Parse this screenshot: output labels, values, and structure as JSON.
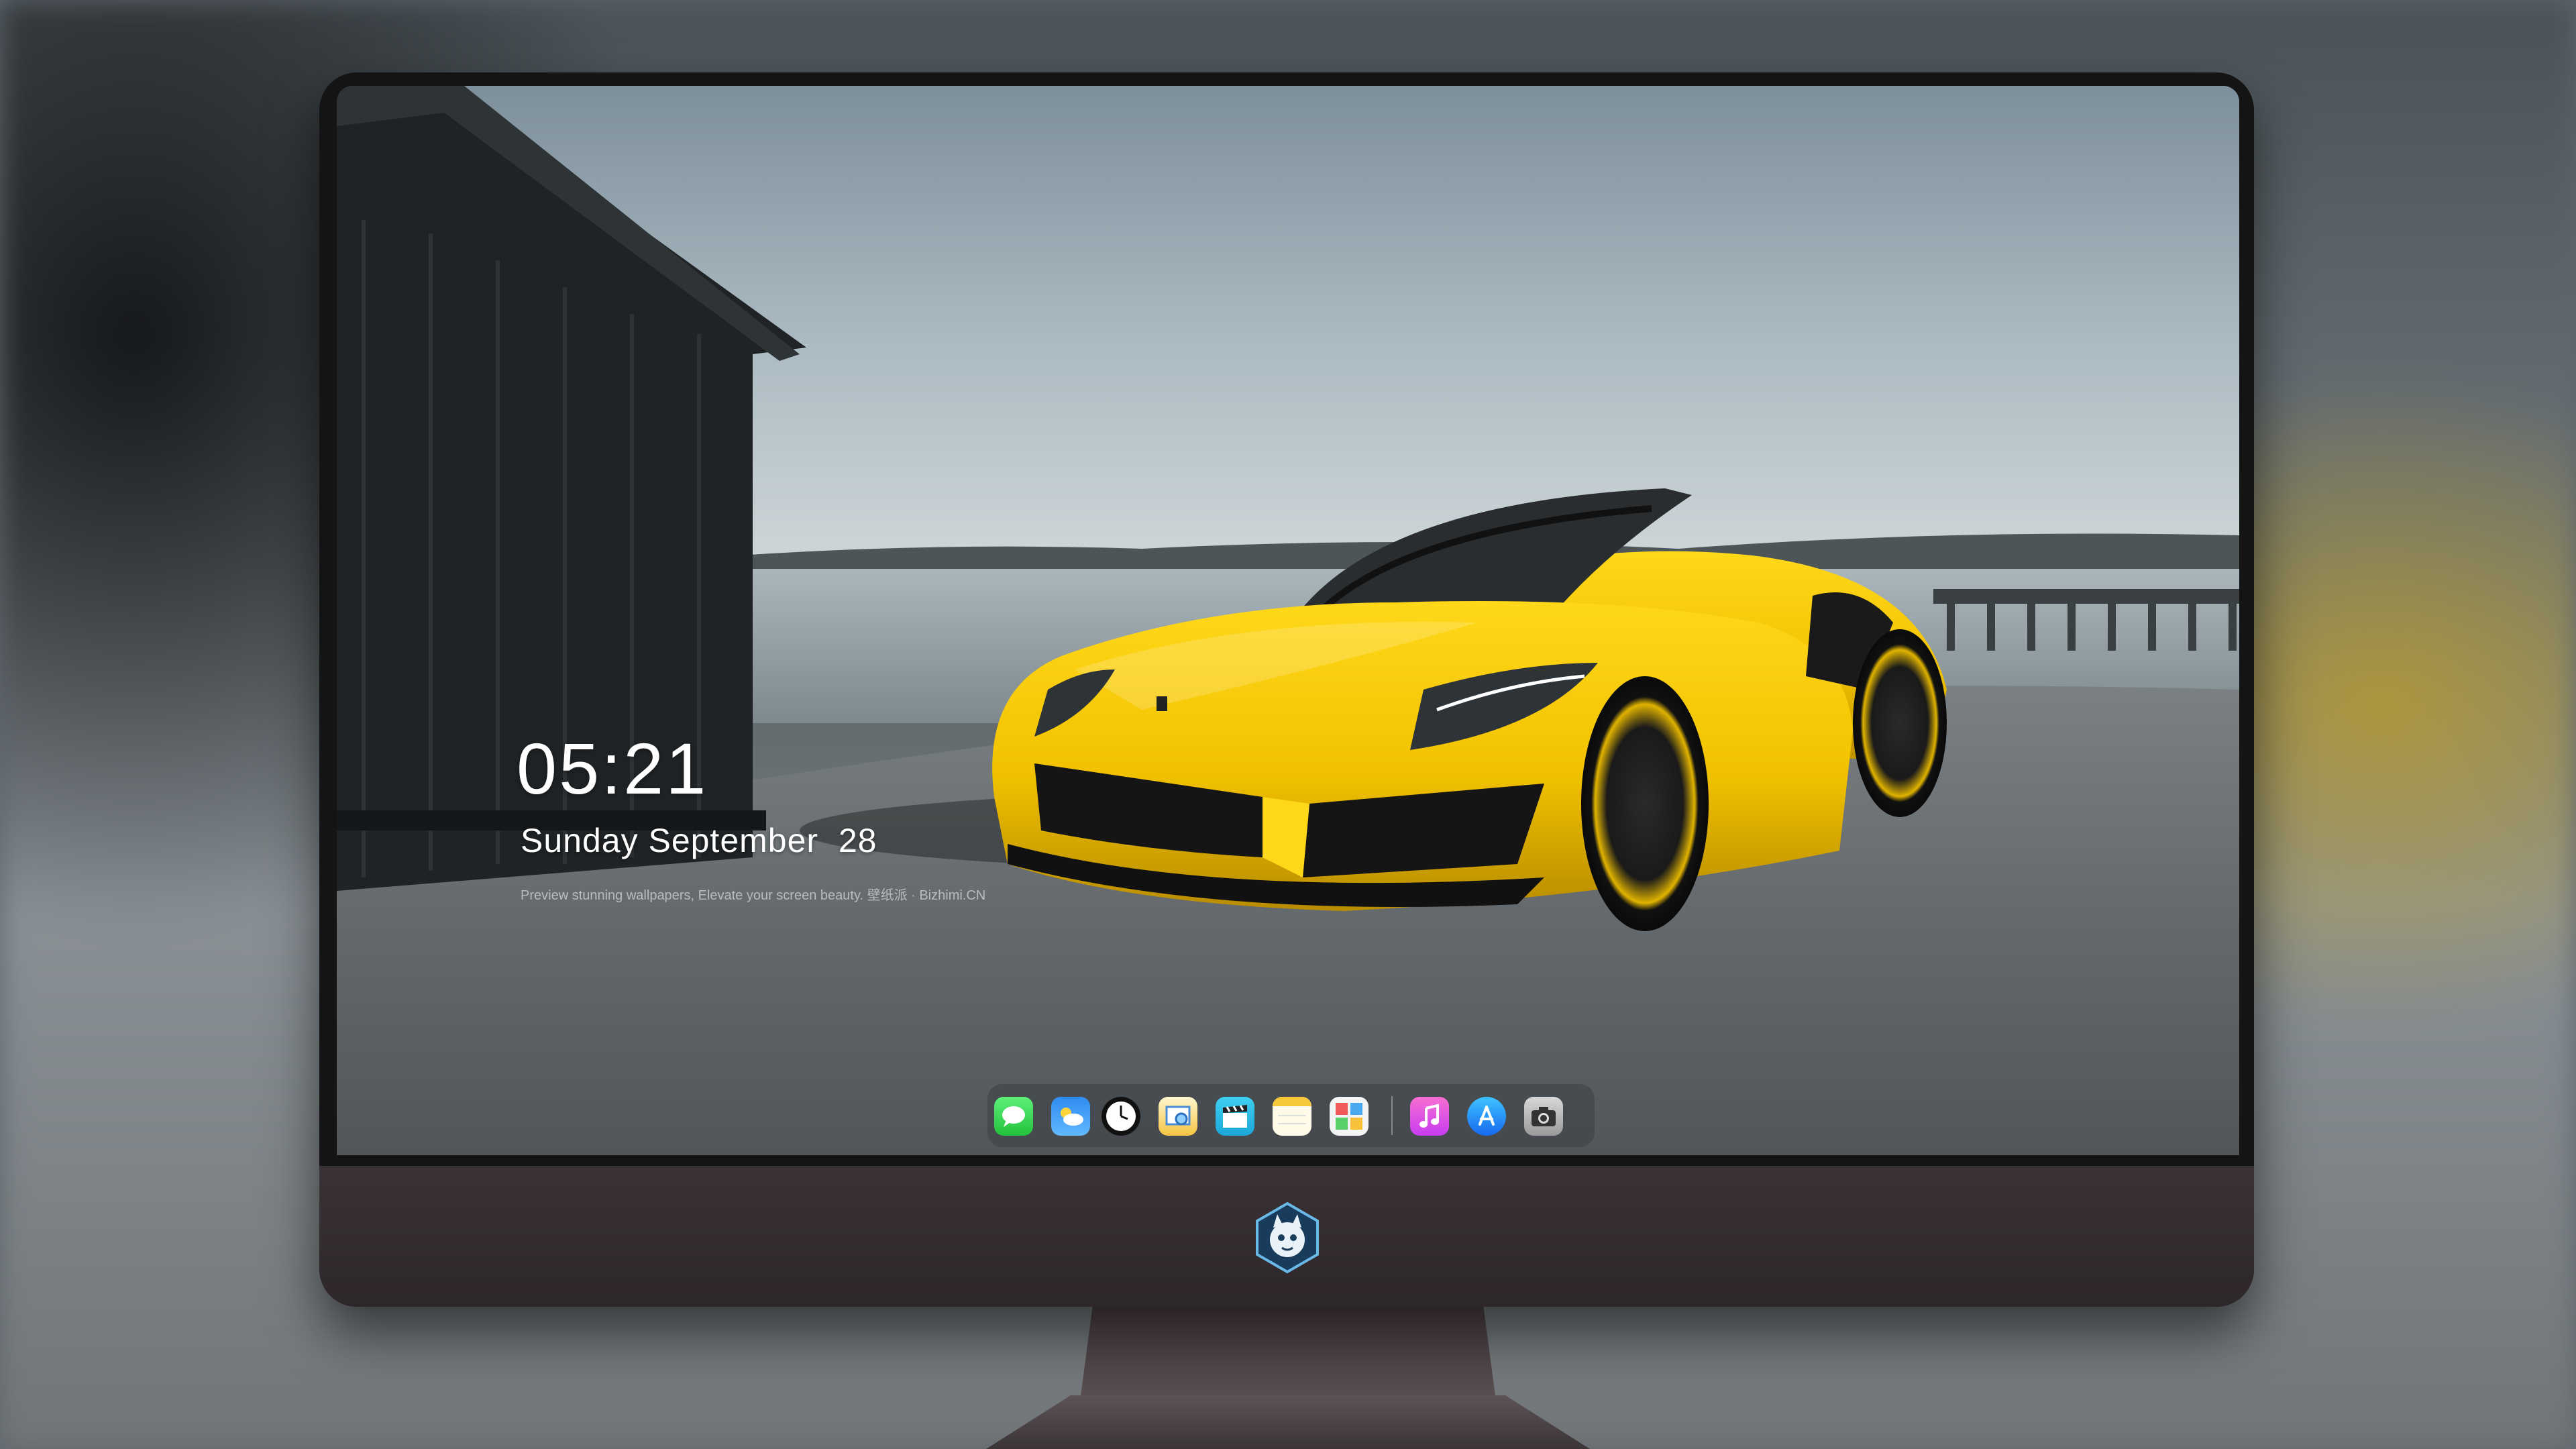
{
  "lockscreen": {
    "time": "05:21",
    "date": "Sunday September  28",
    "caption": "Preview stunning wallpapers, Elevate your screen beauty. 壁纸派 · Bizhimi.CN"
  },
  "dock": {
    "apps": [
      "messages",
      "weather",
      "clock",
      "preview",
      "clips",
      "notes",
      "photo-gallery",
      "music",
      "app-store",
      "camera"
    ]
  },
  "colors": {
    "car": "#f2c200",
    "chin": "#342d2f",
    "bezel": "#141414"
  }
}
